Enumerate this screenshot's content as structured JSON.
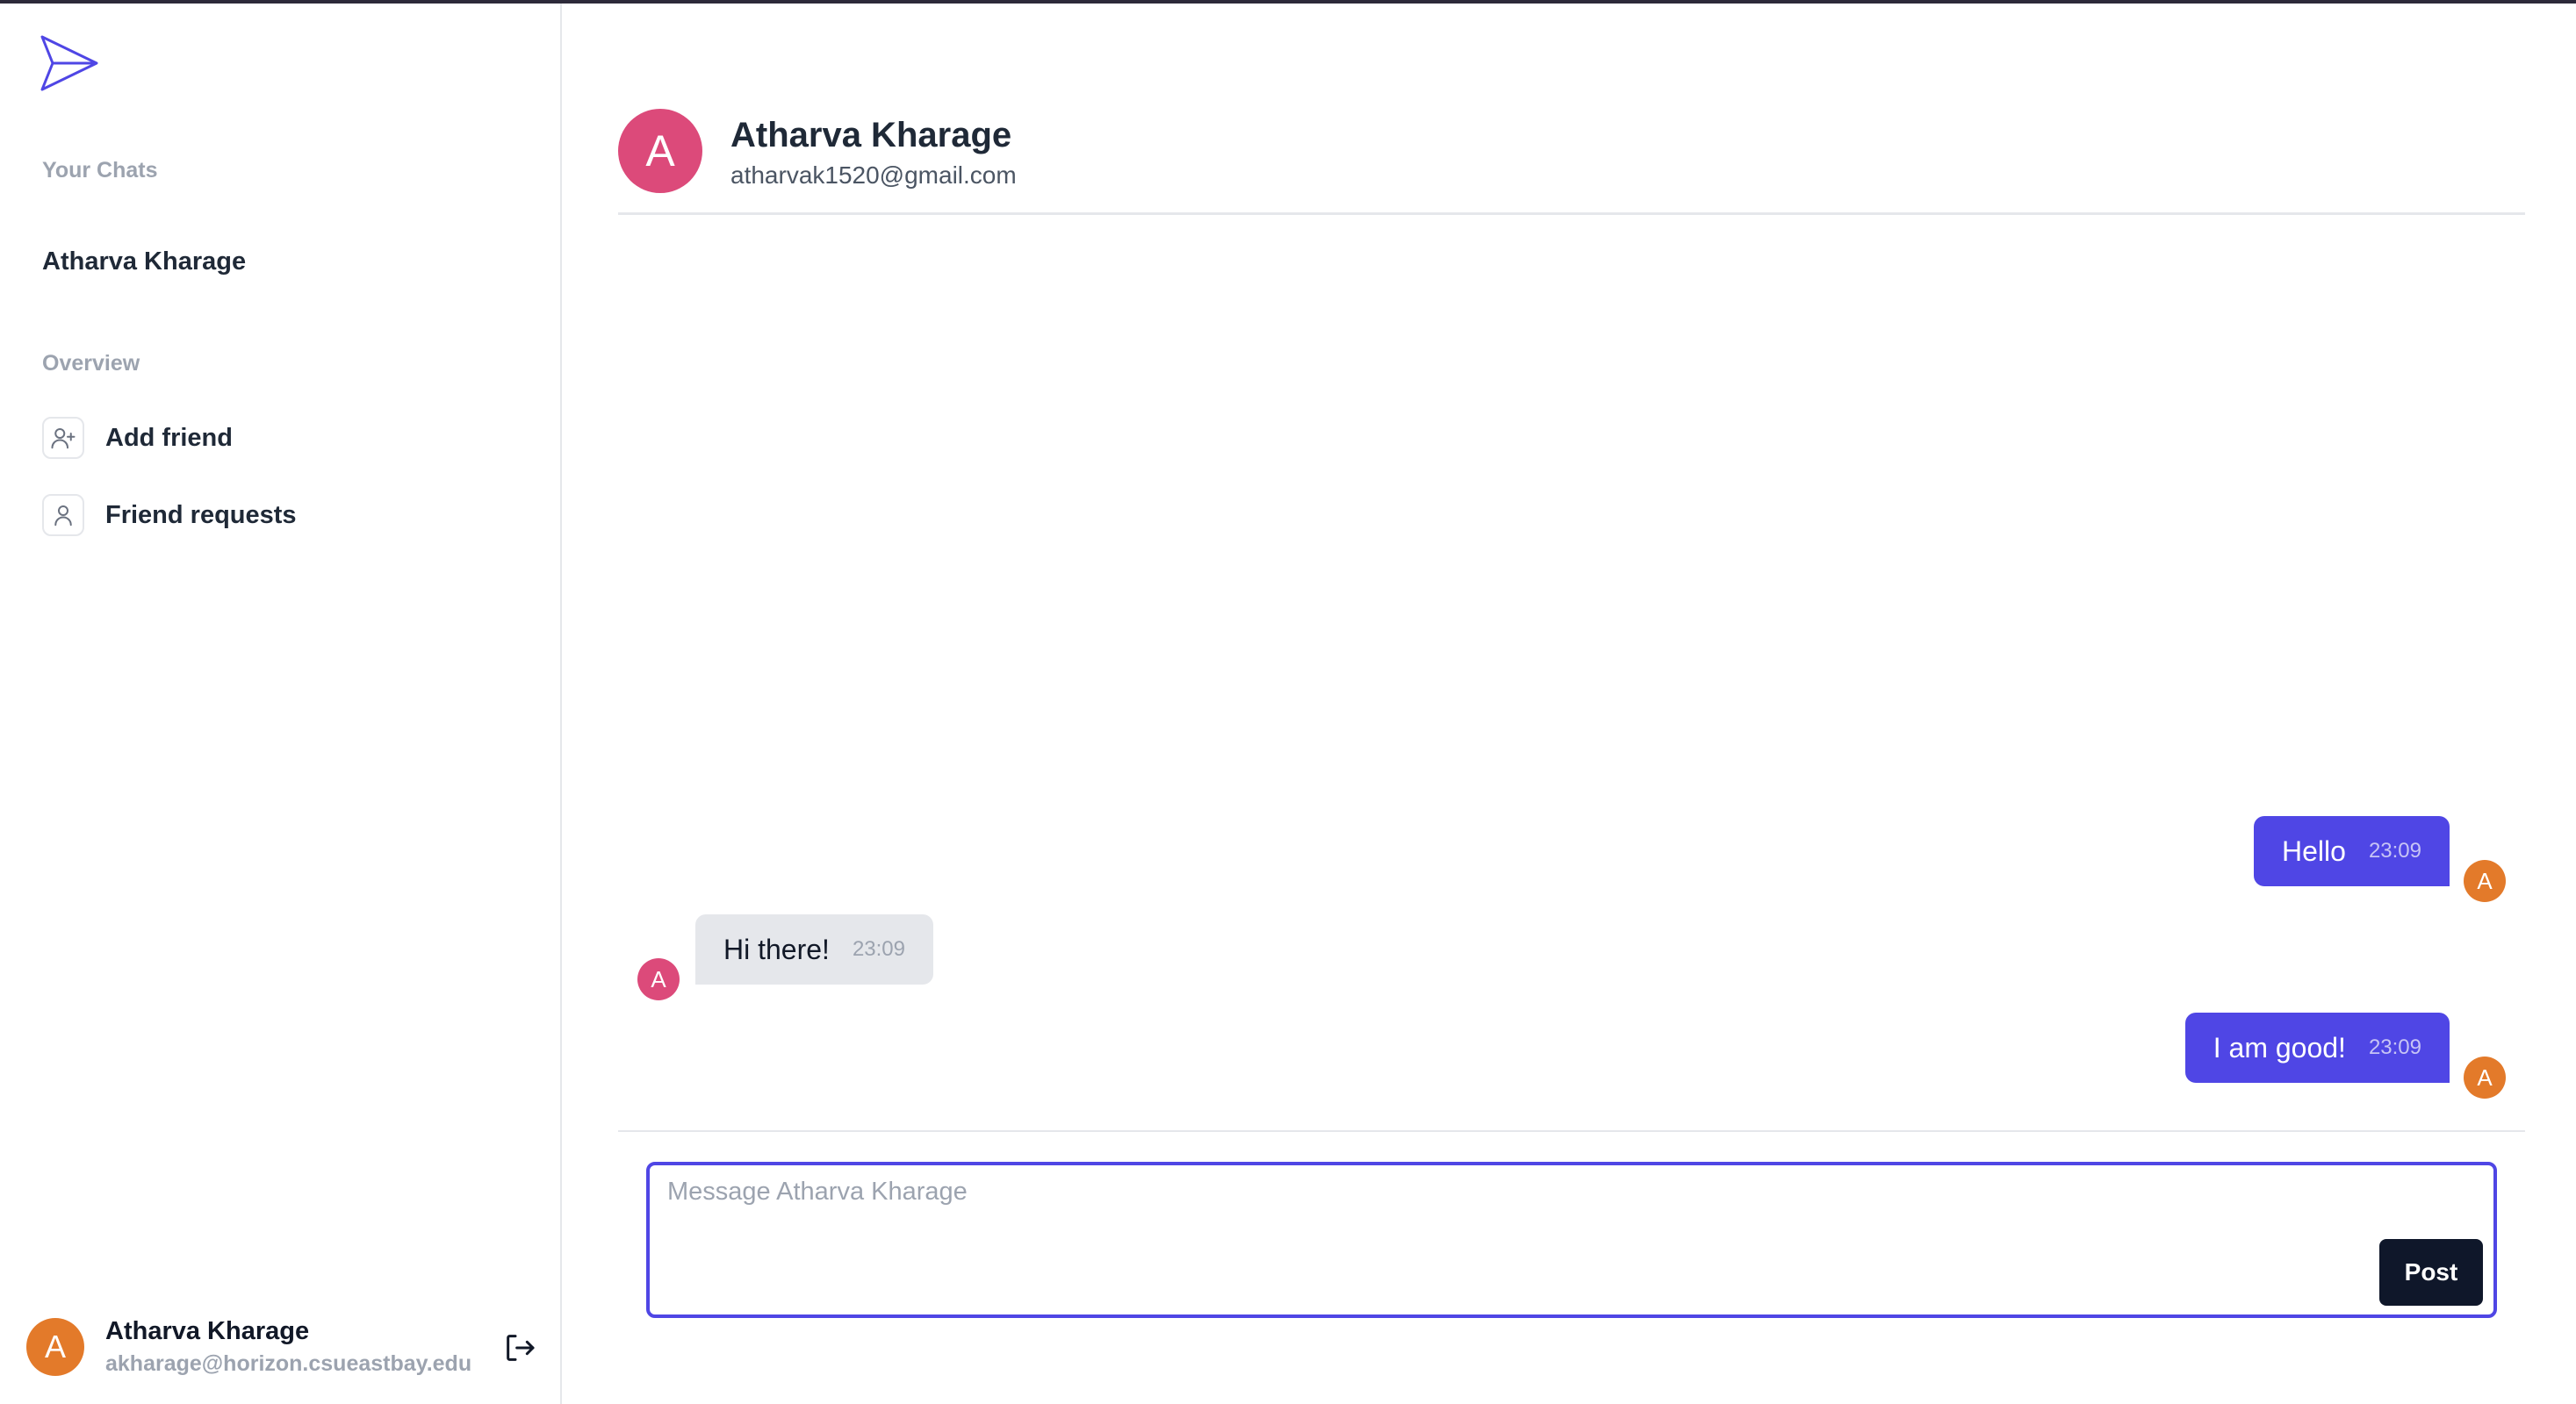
{
  "sidebar": {
    "your_chats_label": "Your Chats",
    "chats": [
      {
        "name": "Atharva Kharage"
      }
    ],
    "overview_label": "Overview",
    "nav": [
      {
        "label": "Add friend",
        "icon": "user-plus-icon"
      },
      {
        "label": "Friend requests",
        "icon": "user-icon"
      }
    ],
    "profile": {
      "initial": "A",
      "name": "Atharva Kharage",
      "email": "akharage@horizon.csueastbay.edu"
    }
  },
  "chat": {
    "partner": {
      "initial": "A",
      "name": "Atharva Kharage",
      "email": "atharvak1520@gmail.com"
    },
    "messages": [
      {
        "sender": "me",
        "text": "Hello",
        "time": "23:09",
        "avatar": "A"
      },
      {
        "sender": "them",
        "text": "Hi there!",
        "time": "23:09",
        "avatar": "A"
      },
      {
        "sender": "me",
        "text": "I am good!",
        "time": "23:09",
        "avatar": "A"
      }
    ],
    "composer": {
      "placeholder": "Message Atharva Kharage",
      "value": "",
      "post_label": "Post"
    }
  },
  "colors": {
    "accent": "#4f46e5",
    "my_avatar": "#e37a2a",
    "partner_avatar": "#dc4a7a",
    "post_button": "#0f172a"
  }
}
